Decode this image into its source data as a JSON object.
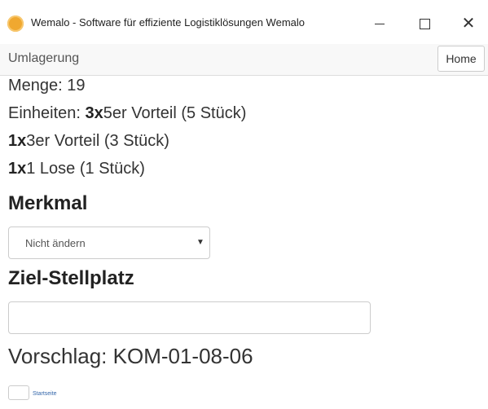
{
  "window": {
    "title": "Wemalo - Software für effiziente Logistiklösungen Wemalo",
    "app_icon": "wemalo-logo-icon",
    "controls": {
      "minimize": "minimize-icon",
      "maximize": "maximize-icon",
      "close_glyph": "✕"
    }
  },
  "toolbar": {
    "title": "Umlagerung",
    "home_label": "Home"
  },
  "details": {
    "menge": "Menge: 19",
    "einheiten_prefix": "Einheiten: ",
    "unit1_count": "3x",
    "unit1_desc": "5er Vorteil (5 Stück)",
    "unit2_count": "1x",
    "unit2_desc": "3er Vorteil (3 Stück)",
    "unit3_count": "1x",
    "unit3_desc": "1 Lose (1 Stück)"
  },
  "merkmal": {
    "heading": "Merkmal",
    "selected": "Nicht ändern",
    "arrow": "▼"
  },
  "ziel": {
    "heading": "Ziel-Stellplatz",
    "value": "",
    "suggestion": "Vorschlag: KOM-01-08-06"
  },
  "footer": {
    "link_label": "Startseite"
  },
  "colors": {
    "accent_icon": "#f0a830",
    "link": "#3366aa",
    "text": "#333333",
    "toolbar_bg": "#f8f8f8"
  }
}
